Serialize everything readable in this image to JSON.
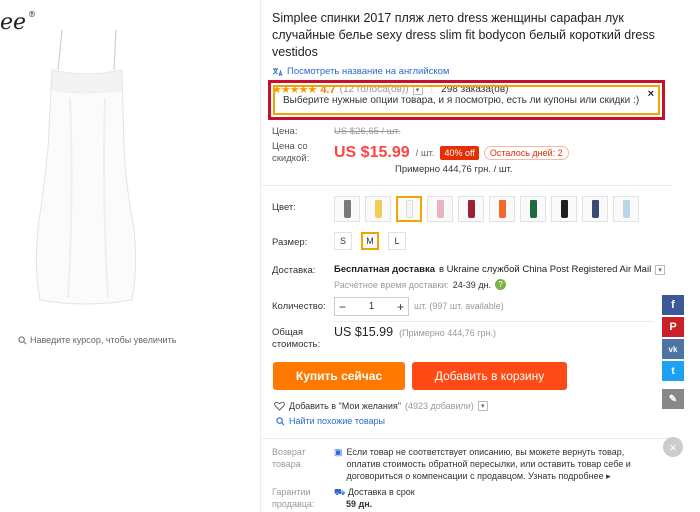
{
  "brand": {
    "text": "ee",
    "reg": "®"
  },
  "product": {
    "title": "Simplee спинки 2017 пляж лето dress женщины сарафан лук случайные белье sexy dress slim fit bodycon белый короткий dress vestidos",
    "translate_link": "Посмотреть название на английском",
    "rating_value": "4.7",
    "rating_votes": "(12 голоса(ов))",
    "orders": "298 заказа(ов)",
    "zoom_hint": "Наведите курсор, чтобы увеличить"
  },
  "coupon": {
    "text": "Выберите нужные опции товара, и я посмотрю, есть ли купоны или скидки :)",
    "close": "×"
  },
  "price": {
    "label": "Цена:",
    "old_price": "US $26,65 / шт.",
    "discount_label_1": "Цена со",
    "discount_label_2": "скидкой:",
    "new_price": "US $15.99",
    "per_unit": "/ шт.",
    "off_badge": "40% off",
    "days_left": "Осталось дней: 2",
    "approx": "Примерно 444,76 грн. / шт."
  },
  "options": {
    "color_label": "Цвет:",
    "colors": [
      {
        "name": "gray",
        "hex": "#7a7a7a"
      },
      {
        "name": "yellow",
        "hex": "#f3cd5a"
      },
      {
        "name": "white",
        "hex": "#f4f4f4"
      },
      {
        "name": "pink",
        "hex": "#e9b4bd"
      },
      {
        "name": "wine",
        "hex": "#9b2235"
      },
      {
        "name": "orange",
        "hex": "#ef6a2c"
      },
      {
        "name": "green",
        "hex": "#1f6b3d"
      },
      {
        "name": "black",
        "hex": "#202020"
      },
      {
        "name": "navy",
        "hex": "#3a4b73"
      },
      {
        "name": "light-blue",
        "hex": "#b8d8ea"
      }
    ],
    "selected_color_index": 2,
    "size_label": "Размер:",
    "sizes": [
      "S",
      "M",
      "L"
    ],
    "selected_size_index": 1
  },
  "shipping": {
    "label": "Доставка:",
    "main_bold": "Бесплатная доставка",
    "main_rest": "в Ukraine службой China Post Registered Air Mail",
    "est_label": "Расчётное время доставки:",
    "est_days": "24-39 дн."
  },
  "quantity": {
    "label": "Количество:",
    "value": "1",
    "minus": "−",
    "plus": "+",
    "available": "шт. (997 шт. available)"
  },
  "total": {
    "label_1": "Общая",
    "label_2": "стоимость:",
    "price": "US $15.99",
    "approx": "(Примерно 444,76 грн.)"
  },
  "actions": {
    "buy_now": "Купить сейчас",
    "add_to_cart": "Добавить в корзину",
    "wishlist": "Добавить в \"Мои желания\"",
    "wishlist_count": "(4923 добавили)",
    "similar": "Найти похожие товары"
  },
  "returns": {
    "label_1": "Возврат",
    "label_2": "товара",
    "text": "Если товар не соответствует описанию, вы можете вернуть товар, оплатив стоимость обратной пересылки, или оставить товар себе и договориться о компенсации с продавцом.",
    "more": "Узнать подробнее ▸",
    "guarantee_label_1": "Гарантии",
    "guarantee_label_2": "продавца:",
    "guarantee_text": "Доставка в срок",
    "guarantee_days": "59 дн."
  },
  "social": {
    "facebook": "f",
    "pinterest": "P",
    "vk": "vk",
    "twitter": "t",
    "edit": "✎",
    "close": "×"
  }
}
